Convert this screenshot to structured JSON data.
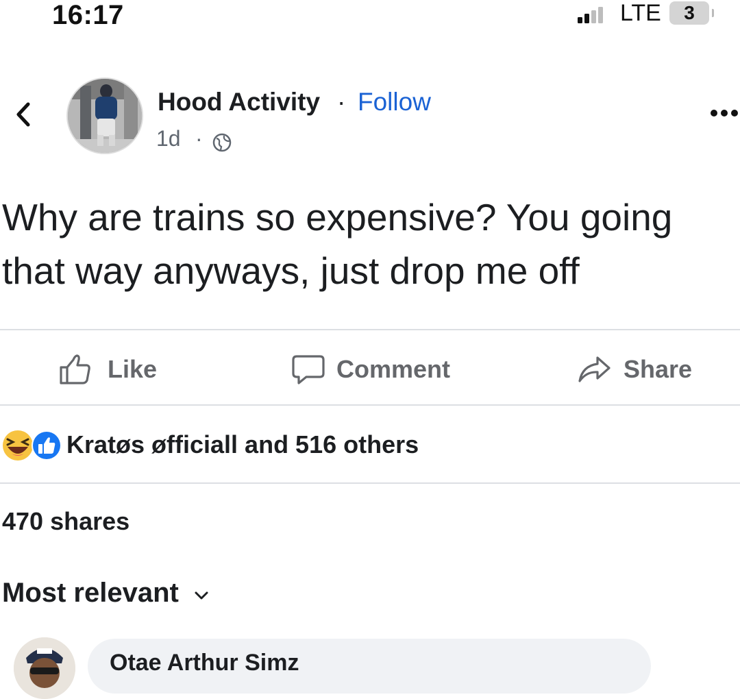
{
  "status_bar": {
    "time": "16:17",
    "network": "LTE",
    "battery_level": "3"
  },
  "post": {
    "page_name": "Hood Activity",
    "separator": "·",
    "follow_label": "Follow",
    "age": "1d",
    "meta_separator": "·",
    "privacy_icon": "globe-icon",
    "text": "Why are trains so expensive? You going that way anyways, just drop me off"
  },
  "actions": {
    "like_label": "Like",
    "comment_label": "Comment",
    "share_label": "Share"
  },
  "reactions": {
    "icons": [
      "laugh-reaction-icon",
      "like-reaction-icon"
    ],
    "summary": "Kratøs øfficiall and 516 others"
  },
  "shares": "470 shares",
  "comments": {
    "sort_label": "Most relevant",
    "first_author": "Otae Arthur Simz"
  },
  "colors": {
    "link_blue": "#1a62d4",
    "muted_gray": "#65676b",
    "divider": "#dcdfe3",
    "like_blue": "#1877f2",
    "laugh_yellow": "#f7c341"
  }
}
